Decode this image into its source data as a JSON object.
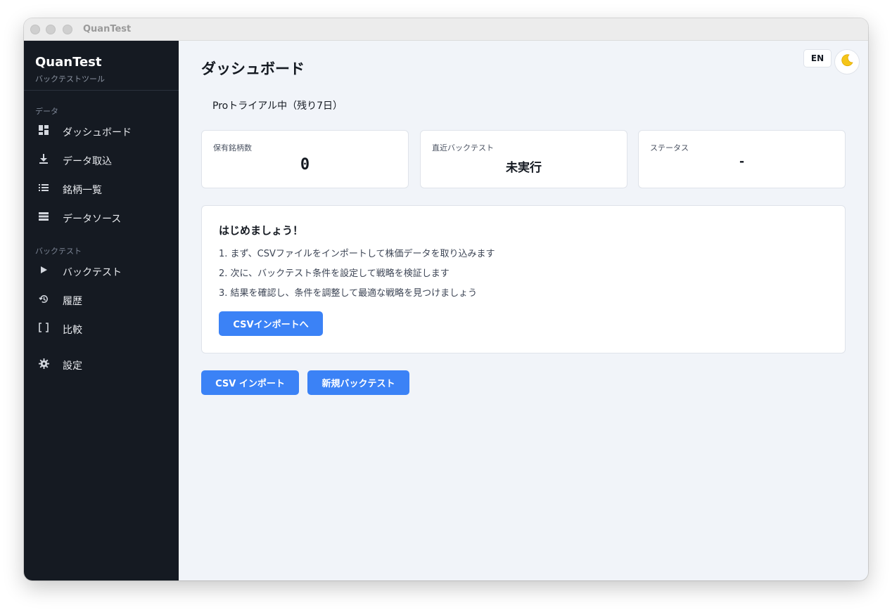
{
  "window": {
    "title": "QuanTest"
  },
  "sidebar": {
    "brand_title": "QuanTest",
    "brand_subtitle": "バックテストツール",
    "sections": [
      {
        "label": "データ",
        "items": [
          {
            "label": "ダッシュボード",
            "icon": "dashboard-icon"
          },
          {
            "label": "データ取込",
            "icon": "download-icon"
          },
          {
            "label": "銘柄一覧",
            "icon": "list-icon"
          },
          {
            "label": "データソース",
            "icon": "storage-icon"
          }
        ]
      },
      {
        "label": "バックテスト",
        "items": [
          {
            "label": "バックテスト",
            "icon": "play-icon"
          },
          {
            "label": "履歴",
            "icon": "history-icon"
          },
          {
            "label": "比較",
            "icon": "brackets-icon"
          }
        ]
      }
    ],
    "settings": {
      "label": "設定",
      "icon": "gear-icon"
    }
  },
  "header": {
    "title": "ダッシュボード",
    "lang_label": "EN",
    "theme_icon": "moon-icon"
  },
  "trial_text": "Proトライアル中（残り7日）",
  "stats": [
    {
      "label": "保有銘柄数",
      "value": "0"
    },
    {
      "label": "直近バックテスト",
      "value": "未実行"
    },
    {
      "label": "ステータス",
      "value": "-"
    }
  ],
  "guide": {
    "title": "はじめましょう！",
    "steps": [
      "1. まず、CSVファイルをインポートして株価データを取り込みます",
      "2. 次に、バックテスト条件を設定して戦略を検証します",
      "3. 結果を確認し、条件を調整して最適な戦略を見つけましょう"
    ],
    "button_label": "CSVインポートへ"
  },
  "actions": {
    "csv_import_label": "CSV インポート",
    "new_backtest_label": "新規バックテスト"
  },
  "colors": {
    "accent": "#3b82f6",
    "sidebar_bg": "#151a22",
    "main_bg": "#f1f4f9"
  }
}
